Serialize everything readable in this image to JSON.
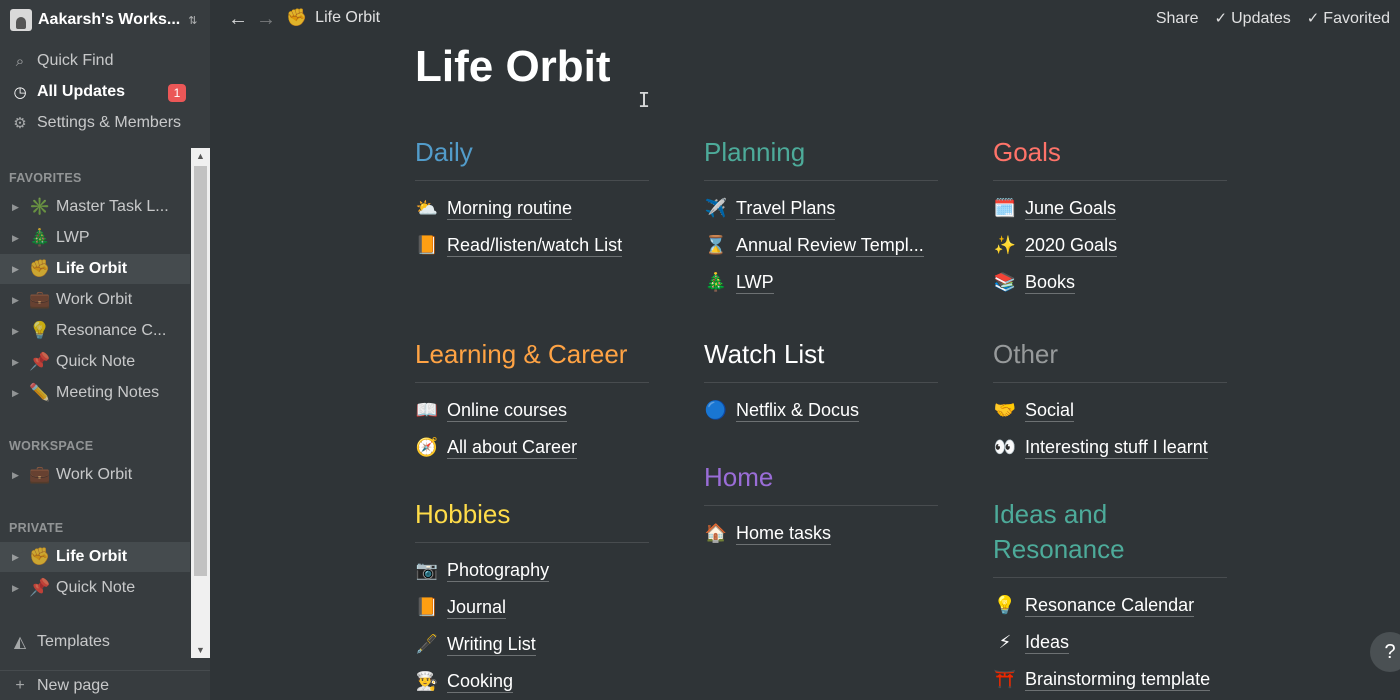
{
  "workspace": {
    "name": "Aakarsh's Works...",
    "chevron": "⌃⌄"
  },
  "nav": {
    "quick_find": "Quick Find",
    "all_updates": "All Updates",
    "updates_badge": "1",
    "settings": "Settings & Members"
  },
  "sections": {
    "favorites": "FAVORITES",
    "workspace": "WORKSPACE",
    "private": "PRIVATE"
  },
  "favorites": [
    {
      "emoji": "✳️",
      "label": "Master Task L..."
    },
    {
      "emoji": "🎄",
      "label": "LWP"
    },
    {
      "emoji": "✊",
      "label": "Life Orbit"
    },
    {
      "emoji": "💼",
      "label": "Work Orbit"
    },
    {
      "emoji": "💡",
      "label": "Resonance C..."
    },
    {
      "emoji": "📌",
      "label": "Quick Note"
    },
    {
      "emoji": "✏️",
      "label": "Meeting Notes"
    }
  ],
  "workspace_pages": [
    {
      "emoji": "💼",
      "label": "Work Orbit"
    }
  ],
  "private_pages": [
    {
      "emoji": "✊",
      "label": "Life Orbit"
    },
    {
      "emoji": "📌",
      "label": "Quick Note"
    }
  ],
  "templates": "Templates",
  "new_page": "New page",
  "topbar": {
    "crumb_emoji": "✊",
    "crumb": "Life Orbit",
    "share": "Share",
    "updates": "Updates",
    "favorited": "Favorited"
  },
  "page": {
    "title": "Life Orbit",
    "help": "?"
  },
  "colors": {
    "daily": "#529cca",
    "planning": "#4dab9a",
    "goals": "#ff7369",
    "learning": "#ffa344",
    "watch": "#ffffff",
    "other": "#979a9b",
    "hobbies": "#ffdc49",
    "home": "#9a6dd7",
    "ideas": "#4dab9a"
  },
  "blocks": {
    "daily": {
      "title": "Daily",
      "links": [
        {
          "emoji": "⛅",
          "label": "Morning routine"
        },
        {
          "emoji": "📙",
          "label": "Read/listen/watch List"
        }
      ]
    },
    "planning": {
      "title": "Planning",
      "links": [
        {
          "emoji": "✈️",
          "label": "Travel Plans"
        },
        {
          "emoji": "⌛",
          "label": "Annual Review Templ..."
        },
        {
          "emoji": "🎄",
          "label": "LWP"
        }
      ]
    },
    "goals": {
      "title": "Goals",
      "links": [
        {
          "emoji": "🗓️",
          "label": "June Goals"
        },
        {
          "emoji": "✨",
          "label": "2020 Goals"
        },
        {
          "emoji": "📚",
          "label": "Books"
        }
      ]
    },
    "learning": {
      "title": "Learning & Career",
      "links": [
        {
          "emoji": "📖",
          "label": "Online courses"
        },
        {
          "emoji": "🧭",
          "label": "All about Career"
        }
      ]
    },
    "watch": {
      "title": "Watch List",
      "links": [
        {
          "emoji": "🔵",
          "label": "Netflix & Docus"
        }
      ]
    },
    "other": {
      "title": "Other",
      "links": [
        {
          "emoji": "🤝",
          "label": "Social"
        },
        {
          "emoji": "👀",
          "label": "Interesting stuff I learnt"
        }
      ]
    },
    "hobbies": {
      "title": "Hobbies",
      "links": [
        {
          "emoji": "📷",
          "label": "Photography"
        },
        {
          "emoji": "📙",
          "label": "Journal"
        },
        {
          "emoji": "🖋️",
          "label": "Writing List"
        },
        {
          "emoji": "👨‍🍳",
          "label": "Cooking"
        }
      ]
    },
    "home": {
      "title": "Home",
      "links": [
        {
          "emoji": "🏠",
          "label": "Home tasks"
        }
      ]
    },
    "ideas": {
      "title": "Ideas and Resonance",
      "links": [
        {
          "emoji": "💡",
          "label": "Resonance Calendar"
        },
        {
          "emoji": "⚡",
          "label": "Ideas"
        },
        {
          "emoji": "⛩️",
          "label": "Brainstorming template"
        }
      ]
    }
  }
}
